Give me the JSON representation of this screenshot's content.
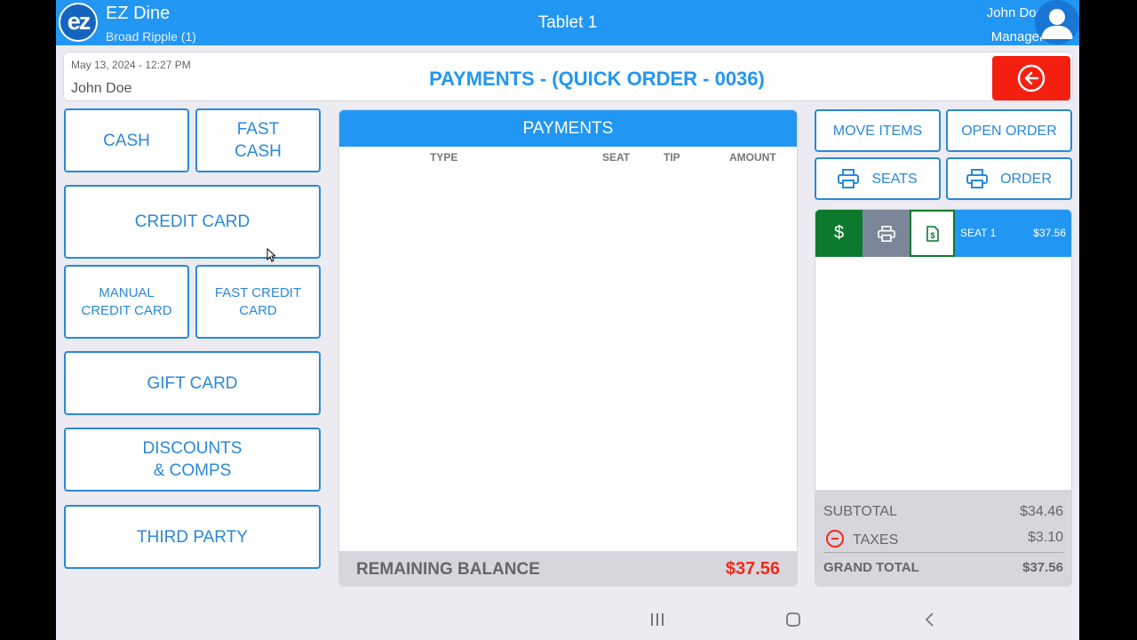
{
  "topbar": {
    "app_name": "EZ Dine",
    "location": "Broad Ripple (1)",
    "device": "Tablet 1",
    "user_name": "John Doe",
    "user_role": "Manager",
    "logo_text": "ez"
  },
  "header": {
    "datetime": "May 13, 2024 - 12:27 PM",
    "employee": "John Doe",
    "title": "PAYMENTS - (QUICK ORDER - 0036)"
  },
  "payment_types": {
    "cash": "CASH",
    "fast_cash": "FAST CASH",
    "credit_card": "CREDIT CARD",
    "manual_credit_card": "MANUAL CREDIT CARD",
    "fast_credit_card": "FAST CREDIT CARD",
    "gift_card": "GIFT CARD",
    "discounts": "DISCOUNTS & COMPS",
    "third_party": "THIRD PARTY"
  },
  "payments": {
    "header": "PAYMENTS",
    "columns": [
      "TYPE",
      "SEAT",
      "TIP",
      "AMOUNT"
    ],
    "rows": [],
    "remaining_label": "REMAINING BALANCE",
    "remaining_value": "$37.56"
  },
  "actions": {
    "move_items": "MOVE ITEMS",
    "open_order": "OPEN ORDER",
    "print_seats": "SEATS",
    "print_order": "ORDER"
  },
  "seats": [
    {
      "pay_symbol": "$",
      "name": "SEAT 1",
      "amount": "$37.56"
    }
  ],
  "totals": {
    "subtotal_label": "SUBTOTAL",
    "subtotal": "$34.46",
    "taxes_label": "TAXES",
    "taxes": "$3.10",
    "grand_total_label": "GRAND TOTAL",
    "grand_total": "$37.56"
  },
  "colors": {
    "primary": "#2196f3",
    "danger": "#f51f0f",
    "success": "#0c7a2c",
    "background": "#ecebf2"
  },
  "icons": [
    "back-arrow-icon",
    "printer-icon",
    "receipt-icon",
    "user-avatar-icon",
    "minus-circle-icon"
  ]
}
